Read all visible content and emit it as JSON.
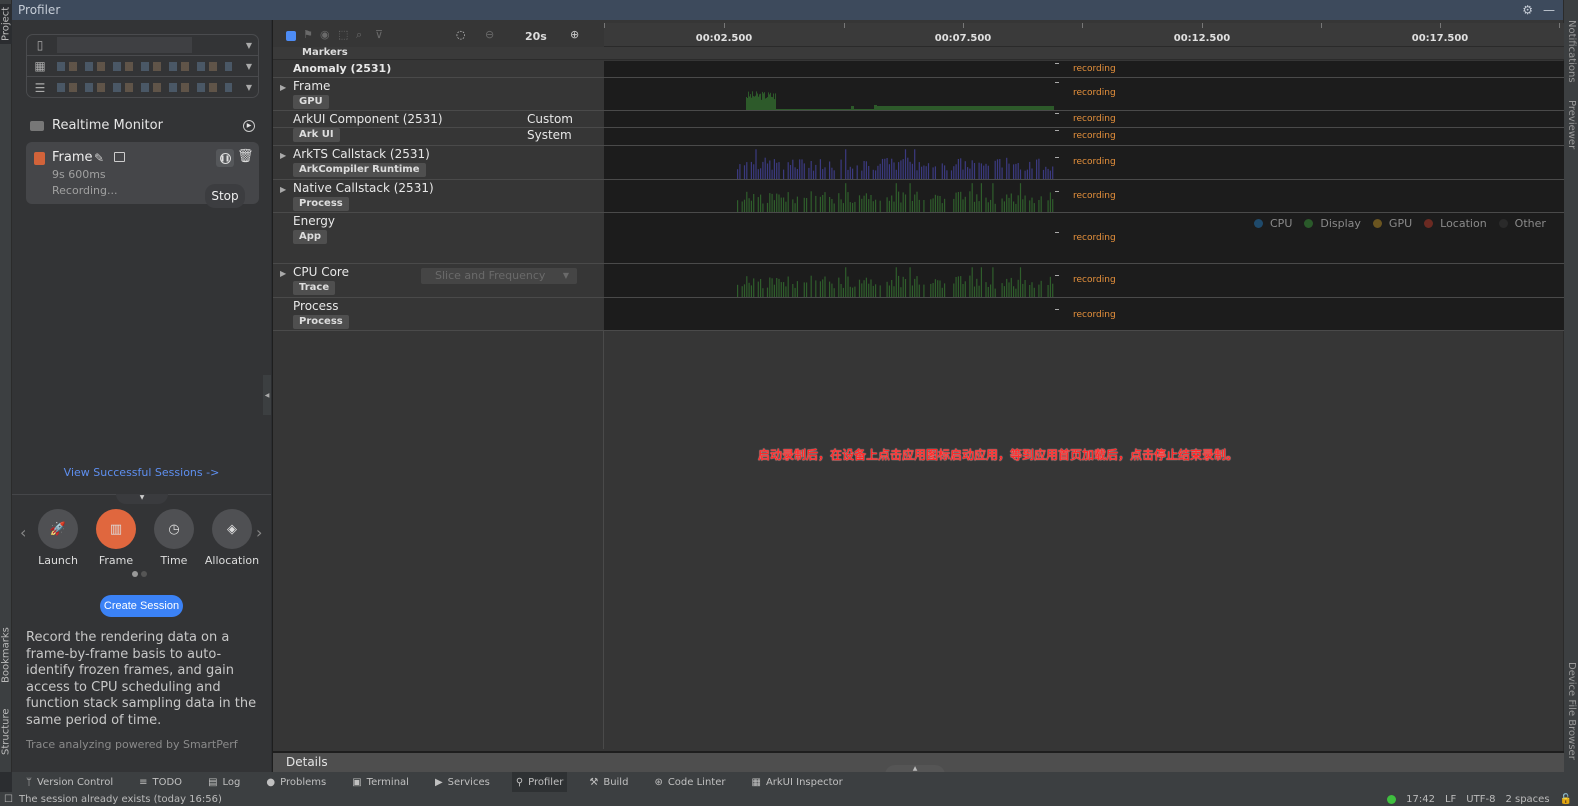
{
  "window": {
    "title": "Profiler"
  },
  "left_strip": {
    "top_tab": "Project",
    "bottom_tabs": [
      "Bookmarks",
      "Structure"
    ]
  },
  "right_strip": {
    "tabs": [
      "Notifications",
      "Previewer",
      "Device File Browser"
    ]
  },
  "left_panel": {
    "device_selectors": [
      {
        "icon": "phone-icon",
        "value": ""
      },
      {
        "icon": "apps-icon",
        "value": "..."
      },
      {
        "icon": "process-icon",
        "value": ""
      }
    ],
    "realtime_monitor": {
      "label": "Realtime Monitor"
    },
    "session": {
      "name": "Frame",
      "duration": "9s 600ms",
      "status": "Recording...",
      "tooltip": "Stop"
    },
    "view_sessions_link": "View Successful Sessions ->",
    "modes": [
      {
        "label": "Launch",
        "icon": "rocket-icon",
        "selected": false
      },
      {
        "label": "Frame",
        "icon": "frame-icon",
        "selected": true
      },
      {
        "label": "Time",
        "icon": "clock-icon",
        "selected": false
      },
      {
        "label": "Allocation",
        "icon": "cube-icon",
        "selected": false
      }
    ],
    "pager": {
      "pages": 2,
      "current": 1
    },
    "create_button": "Create Session",
    "description": "Record the rendering data on a frame-by-frame basis to auto-identify frozen frames, and gain access to CPU scheduling and function stack sampling data in the same period of time.",
    "powered_by": "Trace analyzing powered by SmartPerf"
  },
  "timeline": {
    "zoom_level": "20s",
    "ruler_labels": [
      "00:02.500",
      "00:07.500",
      "00:12.500",
      "00:17.500"
    ],
    "markers_label": "Markers",
    "recording_label": "recording",
    "rows": [
      {
        "title": "Anomaly (2531)",
        "tag": "",
        "expandable": false
      },
      {
        "title": "Frame",
        "tag": "GPU",
        "expandable": true
      },
      {
        "title": "ArkUI Component (2531)",
        "tag": "Ark UI",
        "expandable": false,
        "sublabels": [
          "Custom",
          "System"
        ]
      },
      {
        "title": "ArkTS Callstack (2531)",
        "tag": "ArkCompiler Runtime",
        "expandable": true
      },
      {
        "title": "Native Callstack (2531)",
        "tag": "Process",
        "expandable": true
      },
      {
        "title": "Energy",
        "tag": "App",
        "expandable": false
      },
      {
        "title": "CPU Core",
        "tag": "Trace",
        "expandable": true,
        "dropdown": "Slice and Frequency"
      },
      {
        "title": "Process",
        "tag": "Process",
        "expandable": false
      }
    ],
    "energy_legend": [
      {
        "label": "CPU",
        "color": "#1f4a6b"
      },
      {
        "label": "Display",
        "color": "#2a5a2a"
      },
      {
        "label": "GPU",
        "color": "#6b5520"
      },
      {
        "label": "Location",
        "color": "#6b2a22"
      },
      {
        "label": "Other",
        "color": "#2a2a2a"
      }
    ],
    "hint_text": "启动录制后，在设备上点击应用图标启动应用，等到应用首页加载后，点击停止结束录制。",
    "details_label": "Details"
  },
  "colors": {
    "accent": "#3b82f6",
    "frame_mode": "#e0673e",
    "recording": "#e6913c",
    "gpu_bar": "#2d5a2a",
    "arkts_bar": "#3b3a80",
    "native_bar": "#2f5e2c",
    "hint": "#ff2a2a"
  },
  "bottom_tools": [
    {
      "label": "Version Control",
      "icon": "vcs-icon"
    },
    {
      "label": "TODO",
      "icon": "list-icon"
    },
    {
      "label": "Log",
      "icon": "log-icon"
    },
    {
      "label": "Problems",
      "icon": "problems-icon"
    },
    {
      "label": "Terminal",
      "icon": "terminal-icon"
    },
    {
      "label": "Services",
      "icon": "services-icon"
    },
    {
      "label": "Profiler",
      "icon": "profiler-icon",
      "active": true
    },
    {
      "label": "Build",
      "icon": "hammer-icon"
    },
    {
      "label": "Code Linter",
      "icon": "linter-icon"
    },
    {
      "label": "ArkUI Inspector",
      "icon": "inspector-icon"
    }
  ],
  "status_bar": {
    "message": "The session already exists (today 16:56)",
    "time": "17:42",
    "line_sep": "LF",
    "encoding": "UTF-8",
    "indent": "2 spaces"
  }
}
